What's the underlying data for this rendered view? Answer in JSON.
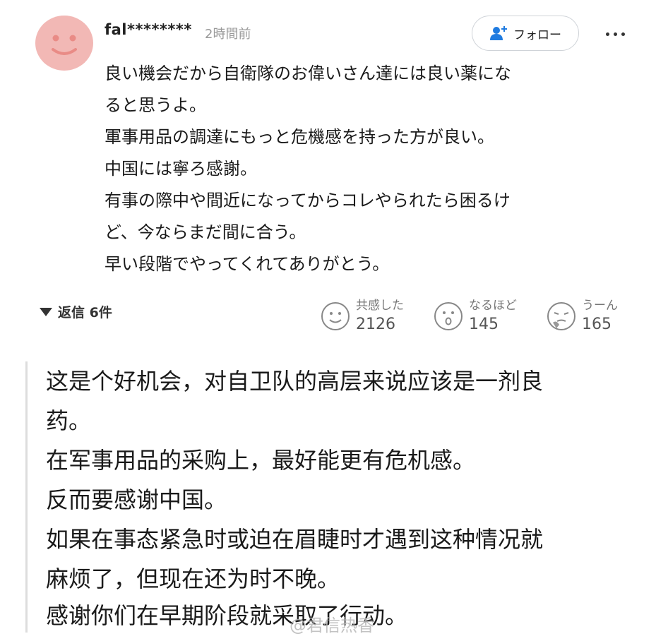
{
  "comment": {
    "username": "fal********",
    "timestamp": "2時間前",
    "follow_label": "フォロー",
    "body_lines": [
      "良い機会だから自衛隊のお偉いさん達には良い薬にな",
      "ると思うよ。",
      "軍事用品の調達にもっと危機感を持った方が良い。",
      "中国には寧ろ感謝。",
      "有事の際中や間近になってからコレやられたら困るけ",
      "ど、今ならまだ間に合う。",
      "早い段階でやってくれてありがとう。"
    ],
    "replies_label": "返信 6件",
    "reactions": [
      {
        "label": "共感した",
        "count": "2126",
        "icon": "smile-face-icon"
      },
      {
        "label": "なるほど",
        "count": "145",
        "icon": "surprised-face-icon"
      },
      {
        "label": "うーん",
        "count": "165",
        "icon": "thinking-face-icon"
      }
    ]
  },
  "translation": {
    "lines": [
      "这是个好机会，对自卫队的高层来说应该是一剂良",
      "药。",
      "在军事用品的采购上，最好能更有危机感。",
      "反而要感谢中国。",
      "如果在事态紧急时或迫在眉睫时才遇到这种情况就",
      "麻烦了，但现在还为时不晚。",
      "感谢你们在早期阶段就采取了行动。"
    ]
  },
  "watermark": "@君信热香",
  "colors": {
    "avatar_bg": "#f2b8b5",
    "follow_icon": "#1f7be0",
    "border": "#cfd3d8"
  }
}
